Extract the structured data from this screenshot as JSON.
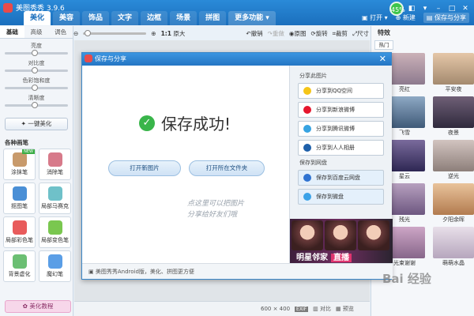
{
  "app": {
    "title": "美图秀秀 3.9.6"
  },
  "main_tabs": [
    {
      "label": "美化",
      "active": true
    },
    {
      "label": "美容"
    },
    {
      "label": "饰品"
    },
    {
      "label": "文字"
    },
    {
      "label": "边框"
    },
    {
      "label": "场景"
    },
    {
      "label": "拼图"
    },
    {
      "label": "更多功能 ▾"
    }
  ],
  "titlebar": {
    "badge": "45%",
    "open_label": "打开 ▾",
    "new_label": "新建",
    "save_share_label": "保存与分享"
  },
  "subtoolbar": {
    "zoom_label": "1:1",
    "zoom_big": "原大",
    "undo": "撤销",
    "redo": "重做",
    "original": "原图",
    "rotate": "旋转",
    "crop": "裁剪",
    "size": "尺寸"
  },
  "left": {
    "tabs": [
      "基础",
      "高级",
      "调色"
    ],
    "sliders": [
      "亮度",
      "对比度",
      "色彩饱和度",
      "清晰度"
    ],
    "one_key": "一键美化",
    "pens_title": "各种画笔",
    "pens": [
      "涂抹笔",
      "消除笔",
      "抠图笔",
      "局部马赛克",
      "局部彩色笔",
      "局部变色笔",
      "背景虚化",
      "魔幻笔"
    ],
    "new_badge": "NEW",
    "tutorial": "美化教程"
  },
  "right": {
    "title": "特效",
    "tab": "热门",
    "effects": [
      "亮红",
      "平安夜",
      "飞雪",
      "夜景",
      "星云",
      "逆光",
      "残光",
      "夕阳余晖",
      "光束谢谢",
      "萌萌水晶"
    ]
  },
  "dialog": {
    "title": "保存与分享",
    "success_text": "保存成功!",
    "open_new": "打开新图片",
    "open_folder": "打开所在文件夹",
    "handwriting_line1": "点这里可以把图片",
    "handwriting_line2": "分享给好友们哦",
    "share_label": "分享此图片",
    "share_buttons": [
      "分享到QQ空间",
      "分享到新浪微博",
      "分享到腾讯微博",
      "分享到人人相册"
    ],
    "save_cloud_label": "保存到网盘",
    "cloud_buttons": [
      "保存到百度云网盘",
      "保存到微盘"
    ],
    "banner_text": "明星邻家",
    "banner_live": "直播",
    "footer": "美图秀秀Android版，美化、拼图更方便"
  },
  "status": {
    "dims": "600 × 400",
    "exif": "EXIF",
    "compare": "对比",
    "preview": "预览"
  },
  "watermark": "Bai 经验"
}
